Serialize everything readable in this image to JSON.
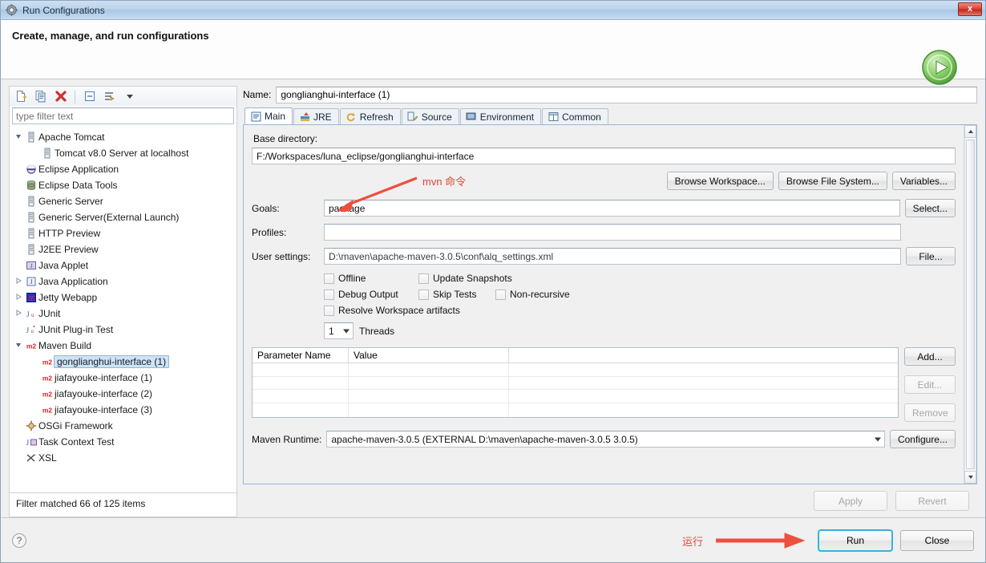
{
  "window": {
    "title": "Run Configurations",
    "title_icon": "gear-icon",
    "close_label": "x"
  },
  "header": {
    "title": "Create, manage, and run configurations",
    "badge_icon": "run-play-icon"
  },
  "left_toolbar": {
    "buttons": [
      {
        "name": "new-configuration-icon",
        "glyph": "new"
      },
      {
        "name": "duplicate-configuration-icon",
        "glyph": "duplicate"
      },
      {
        "name": "delete-configuration-icon",
        "glyph": "delete"
      },
      {
        "name": "collapse-all-icon",
        "glyph": "collapse"
      },
      {
        "name": "filter-icon",
        "glyph": "filter"
      },
      {
        "name": "view-menu-chevron-icon",
        "glyph": "chevron"
      }
    ]
  },
  "filter": {
    "placeholder": "type filter text",
    "value": "",
    "status": "Filter matched 66 of 125 items"
  },
  "tree": [
    {
      "label": "Apache Tomcat",
      "indent": 0,
      "twisty": "expanded",
      "icon": "server-icon",
      "icon_kind": "server",
      "selected": false
    },
    {
      "label": "Tomcat v8.0 Server at localhost",
      "indent": 1,
      "twisty": "",
      "icon": "server-icon",
      "icon_kind": "server",
      "selected": false
    },
    {
      "label": "Eclipse Application",
      "indent": 0,
      "twisty": "",
      "icon": "eclipse-icon",
      "icon_kind": "eclipse",
      "selected": false
    },
    {
      "label": "Eclipse Data Tools",
      "indent": 0,
      "twisty": "",
      "icon": "database-icon",
      "icon_kind": "db",
      "selected": false
    },
    {
      "label": "Generic Server",
      "indent": 0,
      "twisty": "",
      "icon": "server-icon",
      "icon_kind": "server",
      "selected": false
    },
    {
      "label": "Generic Server(External Launch)",
      "indent": 0,
      "twisty": "",
      "icon": "server-icon",
      "icon_kind": "server",
      "selected": false
    },
    {
      "label": "HTTP Preview",
      "indent": 0,
      "twisty": "",
      "icon": "server-icon",
      "icon_kind": "server",
      "selected": false
    },
    {
      "label": "J2EE Preview",
      "indent": 0,
      "twisty": "",
      "icon": "server-icon",
      "icon_kind": "server",
      "selected": false
    },
    {
      "label": "Java Applet",
      "indent": 0,
      "twisty": "",
      "icon": "java-applet-icon",
      "icon_kind": "applet",
      "selected": false
    },
    {
      "label": "Java Application",
      "indent": 0,
      "twisty": "collapsed",
      "icon": "java-application-icon",
      "icon_kind": "javaapp",
      "selected": false
    },
    {
      "label": "Jetty Webapp",
      "indent": 0,
      "twisty": "collapsed",
      "icon": "jetty-icon",
      "icon_kind": "jetty",
      "selected": false
    },
    {
      "label": "JUnit",
      "indent": 0,
      "twisty": "collapsed",
      "icon": "junit-icon",
      "icon_kind": "junit",
      "selected": false
    },
    {
      "label": "JUnit Plug-in Test",
      "indent": 0,
      "twisty": "",
      "icon": "junit-plugin-icon",
      "icon_kind": "junitplug",
      "selected": false
    },
    {
      "label": "Maven Build",
      "indent": 0,
      "twisty": "expanded",
      "icon": "maven-icon",
      "icon_kind": "m2",
      "selected": false
    },
    {
      "label": "gonglianghui-interface (1)",
      "indent": 1,
      "twisty": "",
      "icon": "maven-icon",
      "icon_kind": "m2",
      "selected": true
    },
    {
      "label": "jiafayouke-interface (1)",
      "indent": 1,
      "twisty": "",
      "icon": "maven-icon",
      "icon_kind": "m2",
      "selected": false
    },
    {
      "label": "jiafayouke-interface (2)",
      "indent": 1,
      "twisty": "",
      "icon": "maven-icon",
      "icon_kind": "m2",
      "selected": false
    },
    {
      "label": "jiafayouke-interface (3)",
      "indent": 1,
      "twisty": "",
      "icon": "maven-icon",
      "icon_kind": "m2",
      "selected": false
    },
    {
      "label": "OSGi Framework",
      "indent": 0,
      "twisty": "",
      "icon": "osgi-icon",
      "icon_kind": "osgi",
      "selected": false
    },
    {
      "label": "Task Context Test",
      "indent": 0,
      "twisty": "",
      "icon": "task-context-icon",
      "icon_kind": "taskctx",
      "selected": false
    },
    {
      "label": "XSL",
      "indent": 0,
      "twisty": "",
      "icon": "xsl-icon",
      "icon_kind": "xsl",
      "selected": false
    }
  ],
  "name_field": {
    "label": "Name:",
    "value": "gonglianghui-interface (1)"
  },
  "tabs": [
    {
      "label": "Main",
      "icon": "main-tab-icon",
      "active": true
    },
    {
      "label": "JRE",
      "icon": "jre-tab-icon",
      "active": false
    },
    {
      "label": "Refresh",
      "icon": "refresh-tab-icon",
      "active": false
    },
    {
      "label": "Source",
      "icon": "source-tab-icon",
      "active": false
    },
    {
      "label": "Environment",
      "icon": "environment-tab-icon",
      "active": false
    },
    {
      "label": "Common",
      "icon": "common-tab-icon",
      "active": false
    }
  ],
  "main_tab": {
    "base_directory_label": "Base directory:",
    "base_directory_value": "F:/Workspaces/luna_eclipse/gonglianghui-interface",
    "browse_workspace_label": "Browse Workspace...",
    "browse_filesystem_label": "Browse File System...",
    "variables_label": "Variables...",
    "goals_label": "Goals:",
    "goals_value": "package",
    "goals_select_label": "Select...",
    "profiles_label": "Profiles:",
    "profiles_value": "",
    "user_settings_label": "User settings:",
    "user_settings_value": "D:\\maven\\apache-maven-3.0.5\\conf\\alq_settings.xml",
    "user_settings_file_label": "File...",
    "checkboxes": [
      {
        "label": "Offline",
        "checked": false
      },
      {
        "label": "Update Snapshots",
        "checked": false
      },
      {
        "label": "Debug Output",
        "checked": false
      },
      {
        "label": "Skip Tests",
        "checked": false
      },
      {
        "label": "Non-recursive",
        "checked": false
      },
      {
        "label": "Resolve Workspace artifacts",
        "checked": false
      }
    ],
    "threads_value": "1",
    "threads_label": "Threads",
    "parameters": {
      "columns": [
        "Parameter Name",
        "Value",
        ""
      ],
      "rows": [],
      "add_label": "Add...",
      "edit_label": "Edit...",
      "remove_label": "Remove"
    },
    "maven_runtime_label": "Maven Runtime:",
    "maven_runtime_value": "apache-maven-3.0.5 (EXTERNAL D:\\maven\\apache-maven-3.0.5 3.0.5)",
    "configure_label": "Configure..."
  },
  "actions": {
    "apply_label": "Apply",
    "revert_label": "Revert",
    "run_label": "Run",
    "close_label": "Close",
    "help_label": "?"
  },
  "annotations": [
    {
      "name": "mvn-command-annotation",
      "text": "mvn 命令",
      "color": "#e8443a"
    },
    {
      "name": "run-annotation",
      "text": "运行",
      "color": "#e8443a"
    }
  ]
}
